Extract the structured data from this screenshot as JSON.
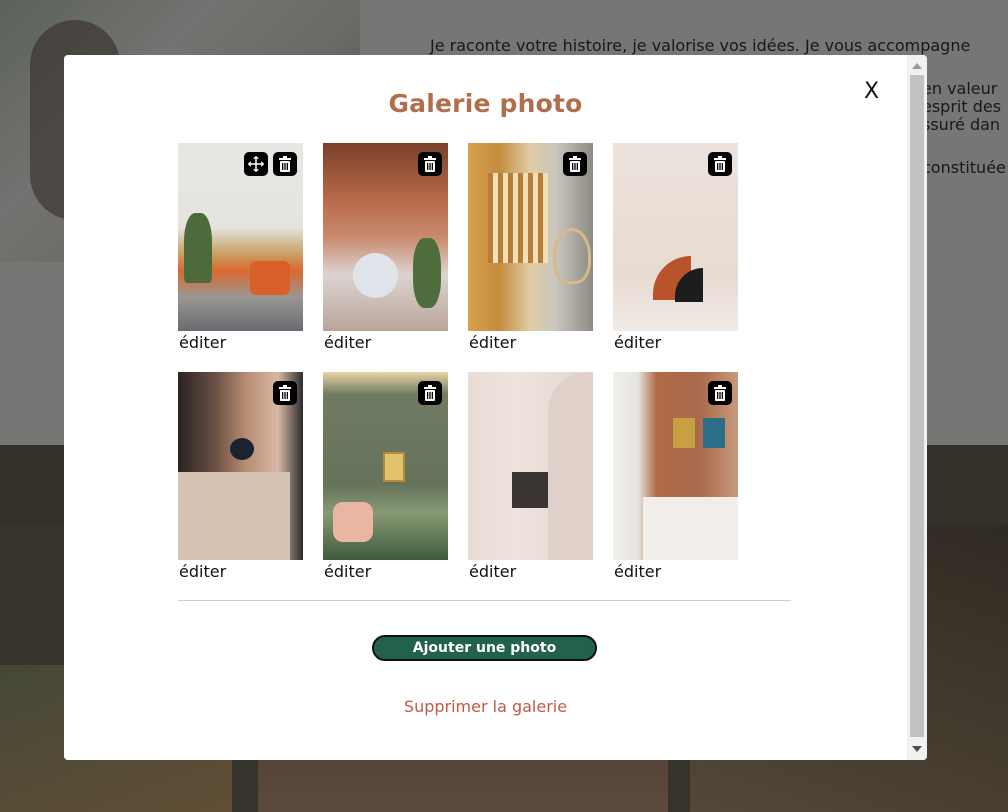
{
  "background": {
    "text_lines": [
      "Je raconte votre histoire, je valorise vos idées. Je vous accompagne",
      "en valeur",
      "esprit des",
      "ssuré dan",
      "constituée"
    ]
  },
  "modal": {
    "title": "Galerie photo",
    "close_label": "X",
    "edit_label": "éditer",
    "photos": [
      {
        "icon": "trash-icon",
        "has_move": true
      },
      {
        "icon": "trash-icon",
        "has_move": false
      },
      {
        "icon": "trash-icon",
        "has_move": false
      },
      {
        "icon": "trash-icon",
        "has_move": false
      },
      {
        "icon": "trash-icon",
        "has_move": false
      },
      {
        "icon": "trash-icon",
        "has_move": false
      },
      {
        "icon": "trash-icon",
        "has_move": false
      },
      {
        "icon": "trash-icon",
        "has_move": false
      }
    ],
    "add_photo_label": "Ajouter une photo",
    "delete_gallery_label": "Supprimer la galerie"
  },
  "colors": {
    "title": "#b06e4b",
    "add_button": "#22614d",
    "delete_link": "#c05a48"
  }
}
